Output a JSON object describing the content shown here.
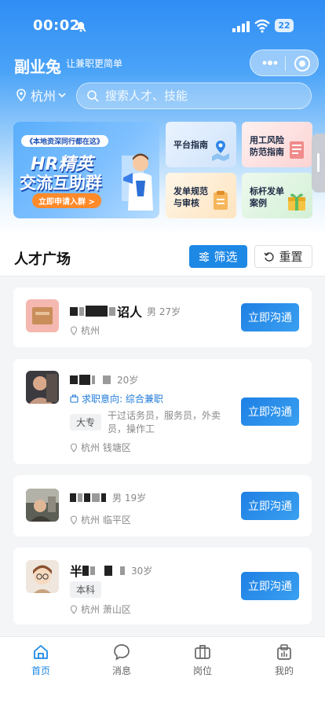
{
  "status_bar": {
    "time": "00:02",
    "battery": "22"
  },
  "header": {
    "title": "副业兔",
    "subtitle": "让兼职更简单"
  },
  "location": {
    "city": "杭州"
  },
  "search": {
    "placeholder": "搜索人才、技能"
  },
  "banner": {
    "top_text": "《本地资深同行都在这》",
    "line1": "HR精英",
    "line2": "交流互助群",
    "button": "立即申请入群 >"
  },
  "quick_links": [
    {
      "label": "平台指南",
      "icon": "map-icon"
    },
    {
      "label": "用工风险防范指南",
      "icon": "document-icon"
    },
    {
      "label": "发单规范与审核",
      "icon": "checklist-icon"
    },
    {
      "label": "标杆发单案例",
      "icon": "gift-box-icon"
    }
  ],
  "section": {
    "title": "人才广场",
    "filter": "筛选",
    "reset": "重置"
  },
  "candidates": [
    {
      "name_suffix": "诏人",
      "meta": "男 27岁",
      "location": "杭州",
      "button": "立即沟通"
    },
    {
      "meta": "20岁",
      "intent": "求职意向: 综合兼职",
      "education": "大专",
      "skills": "干过话务员，服务员，外卖员，操作工",
      "location": "杭州 钱塘区",
      "button": "立即沟通"
    },
    {
      "meta": "男 19岁",
      "location": "杭州 临平区",
      "button": "立即沟通"
    },
    {
      "name_prefix": "半",
      "meta": "30岁",
      "education": "本科",
      "location": "杭州 萧山区",
      "button": "立即沟通"
    }
  ],
  "tabbar": [
    {
      "label": "首页",
      "icon": "home-icon",
      "active": true
    },
    {
      "label": "消息",
      "icon": "message-icon"
    },
    {
      "label": "岗位",
      "icon": "briefcase-icon"
    },
    {
      "label": "我的",
      "icon": "profile-icon"
    }
  ],
  "colors": {
    "primary": "#1e88e5",
    "header_gradient_top": "#2f8df5"
  }
}
